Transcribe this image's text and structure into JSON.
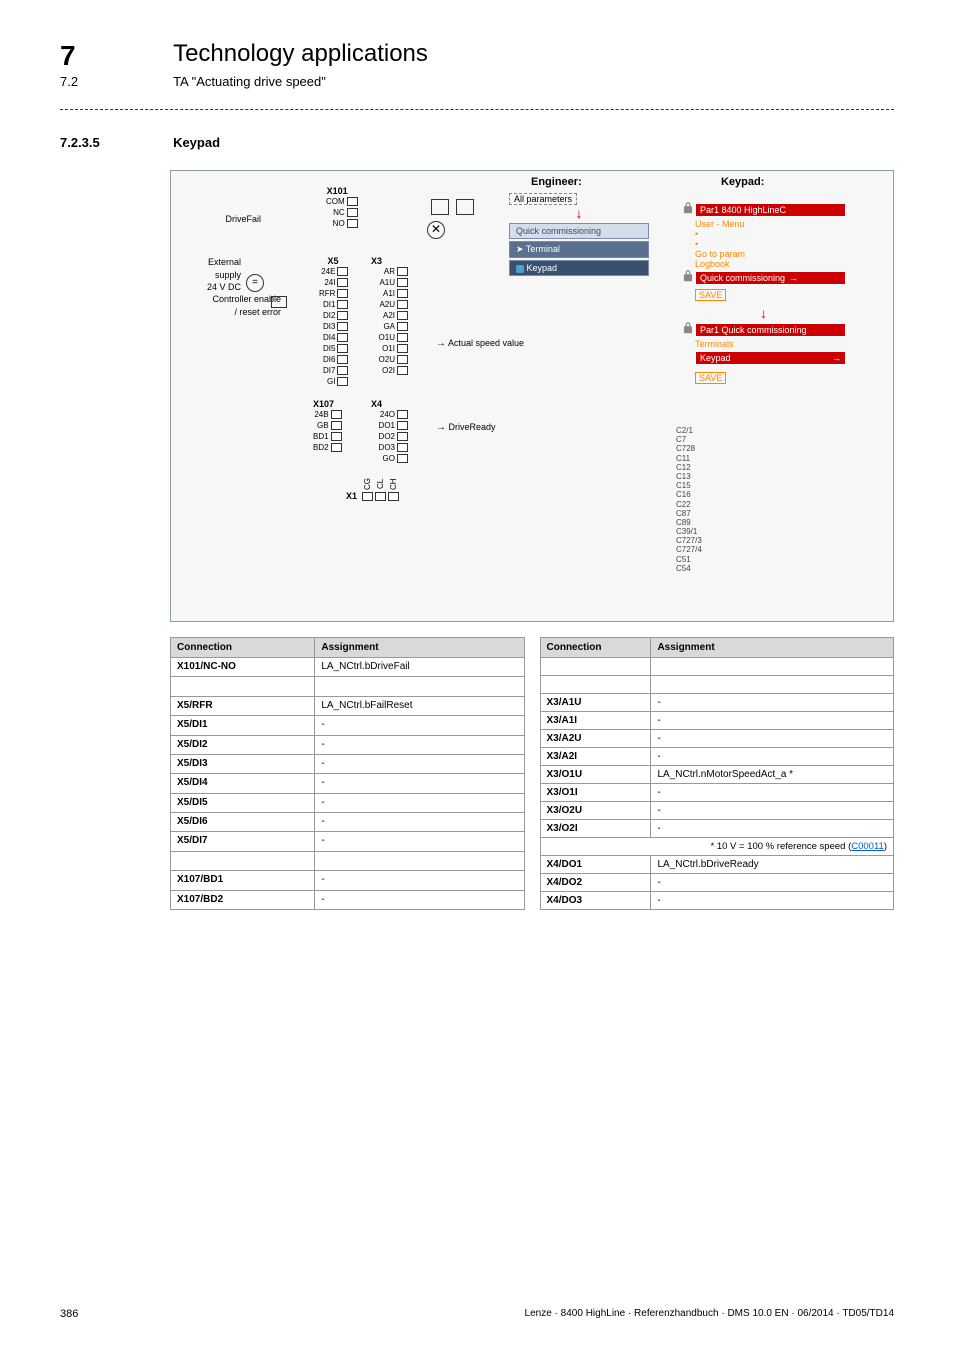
{
  "header": {
    "chapter_num": "7",
    "chapter_title": "Technology applications",
    "sub_num": "7.2",
    "sub_title": "TA \"Actuating drive speed\""
  },
  "section": {
    "num": "7.2.3.5",
    "title": "Keypad"
  },
  "diagram": {
    "col_engineer": "Engineer:",
    "col_keypad": "Keypad:",
    "left_labels": {
      "drivefail": "DriveFail",
      "external": "External",
      "supply": "supply",
      "voltage": "24 V DC",
      "controller_enable": "Controller enable",
      "reset_error": "/ reset error"
    },
    "x101": {
      "header": "X101",
      "pins": [
        "COM",
        "NC",
        "NO"
      ]
    },
    "x5": {
      "header": "X5",
      "pins": [
        "24E",
        "24I",
        "RFR",
        "DI1",
        "DI2",
        "DI3",
        "DI4",
        "DI5",
        "DI6",
        "DI7",
        "GI"
      ]
    },
    "x3": {
      "header": "X3",
      "pins": [
        "AR",
        "A1U",
        "A1I",
        "A2U",
        "A2I",
        "GA",
        "O1U",
        "O1I",
        "O2U",
        "O2I"
      ]
    },
    "x107": {
      "header": "X107",
      "pins": [
        "24B",
        "GB",
        "BD1",
        "BD2"
      ]
    },
    "x4": {
      "header": "X4",
      "pins": [
        "24O",
        "DO1",
        "DO2",
        "DO3",
        "GO"
      ]
    },
    "x1": {
      "header": "X1",
      "pins": [
        "CG",
        "CL",
        "CH"
      ]
    },
    "annotations": {
      "actual_speed": "Actual speed value",
      "drive_ready": "DriveReady"
    },
    "engineer_panel": {
      "all_params": "All parameters",
      "quick_comm": "Quick commissioning",
      "terminal": "Terminal",
      "keypad": "Keypad"
    },
    "keypad_panel": {
      "par1_8400": "Par1 8400 HighLineC",
      "user_menu": "User - Menu",
      "goto_param": "Go to param",
      "logbook": "Logbook",
      "quick_comm": "Quick commissioning",
      "save1": "SAVE",
      "par1_quick": "Par1 Quick commissioning",
      "terminals": "Terminals",
      "keypad": "Keypad",
      "save2": "SAVE"
    },
    "codes": [
      "C2/1",
      "C7",
      "C728",
      "C11",
      "C12",
      "C13",
      "C15",
      "C16",
      "C22",
      "C87",
      "C89",
      "C39/1",
      "C727/3",
      "C727/4",
      "C51",
      "C54"
    ]
  },
  "table_left": {
    "headers": [
      "Connection",
      "Assignment"
    ],
    "rows": [
      {
        "c": "X101/NC-NO",
        "a": "LA_NCtrl.bDriveFail"
      },
      {
        "c": "",
        "a": ""
      },
      {
        "c": "X5/RFR",
        "a": "LA_NCtrl.bFailReset"
      },
      {
        "c": "X5/DI1",
        "a": "-"
      },
      {
        "c": "X5/DI2",
        "a": "-"
      },
      {
        "c": "X5/DI3",
        "a": "-"
      },
      {
        "c": "X5/DI4",
        "a": "-"
      },
      {
        "c": "X5/DI5",
        "a": "-"
      },
      {
        "c": "X5/DI6",
        "a": "-"
      },
      {
        "c": "X5/DI7",
        "a": "-"
      },
      {
        "c": "",
        "a": ""
      },
      {
        "c": "X107/BD1",
        "a": "-"
      },
      {
        "c": "X107/BD2",
        "a": "-"
      }
    ]
  },
  "table_right": {
    "headers": [
      "Connection",
      "Assignment"
    ],
    "rows": [
      {
        "c": "",
        "a": ""
      },
      {
        "c": "",
        "a": ""
      },
      {
        "c": "X3/A1U",
        "a": "-"
      },
      {
        "c": "X3/A1I",
        "a": "-"
      },
      {
        "c": "X3/A2U",
        "a": "-"
      },
      {
        "c": "X3/A2I",
        "a": "-"
      },
      {
        "c": "X3/O1U",
        "a": "LA_NCtrl.nMotorSpeedAct_a *"
      },
      {
        "c": "X3/O1I",
        "a": "-"
      },
      {
        "c": "X3/O2U",
        "a": "-"
      },
      {
        "c": "X3/O2I",
        "a": "-"
      }
    ],
    "footnote_prefix": "* 10 V = 100 % reference speed (",
    "footnote_link": "C00011",
    "footnote_suffix": ")",
    "rows2": [
      {
        "c": "X4/DO1",
        "a": "LA_NCtrl.bDriveReady"
      },
      {
        "c": "X4/DO2",
        "a": "-"
      },
      {
        "c": "X4/DO3",
        "a": "-"
      }
    ]
  },
  "footer": {
    "page": "386",
    "doc": "Lenze · 8400 HighLine · Referenzhandbuch · DMS 10.0 EN · 06/2014 · TD05/TD14"
  }
}
